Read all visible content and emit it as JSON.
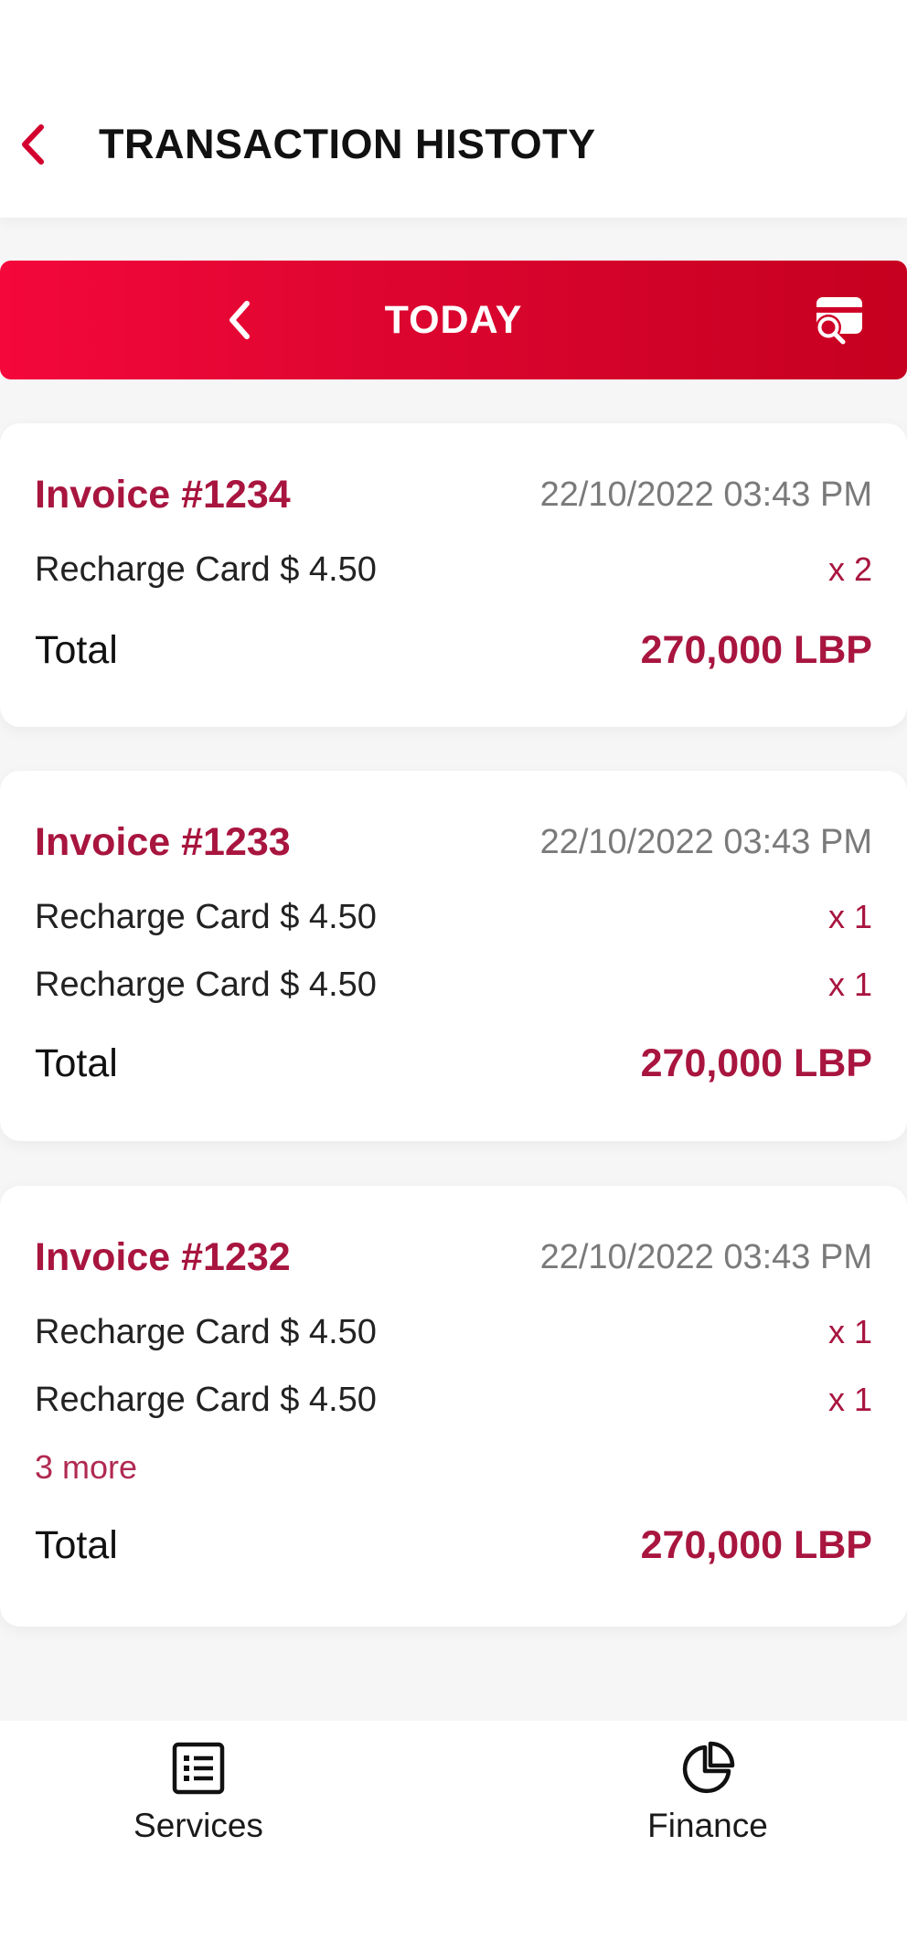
{
  "header": {
    "title": "TRANSACTION HISTOTY",
    "back_icon": "chevron-left-icon"
  },
  "date_bar": {
    "label": "TODAY",
    "prev_icon": "chevron-left-icon",
    "search_icon": "card-search-icon"
  },
  "invoices": [
    {
      "title": "Invoice #1234",
      "date": "22/10/2022 03:43 PM",
      "items": [
        {
          "name": "Recharge Card $ 4.50",
          "qty": "x 2"
        }
      ],
      "more": "",
      "total_label": "Total",
      "total_value": "270,000 LBP"
    },
    {
      "title": "Invoice #1233",
      "date": "22/10/2022 03:43 PM",
      "items": [
        {
          "name": "Recharge Card $ 4.50",
          "qty": "x 1"
        },
        {
          "name": "Recharge Card $ 4.50",
          "qty": "x 1"
        }
      ],
      "more": "",
      "total_label": "Total",
      "total_value": "270,000 LBP"
    },
    {
      "title": "Invoice #1232",
      "date": "22/10/2022 03:43 PM",
      "items": [
        {
          "name": "Recharge Card $ 4.50",
          "qty": "x 1"
        },
        {
          "name": "Recharge Card $ 4.50",
          "qty": "x 1"
        }
      ],
      "more": "3 more",
      "total_label": "Total",
      "total_value": "270,000 LBP"
    }
  ],
  "bottom_nav": {
    "services": {
      "label": "Services",
      "icon": "list-icon"
    },
    "finance": {
      "label": "Finance",
      "icon": "pie-chart-icon"
    }
  },
  "colors": {
    "accent": "#a8153f",
    "bar_start": "#f4073b",
    "bar_end": "#c6001f",
    "back_arrow": "#d3002f"
  }
}
